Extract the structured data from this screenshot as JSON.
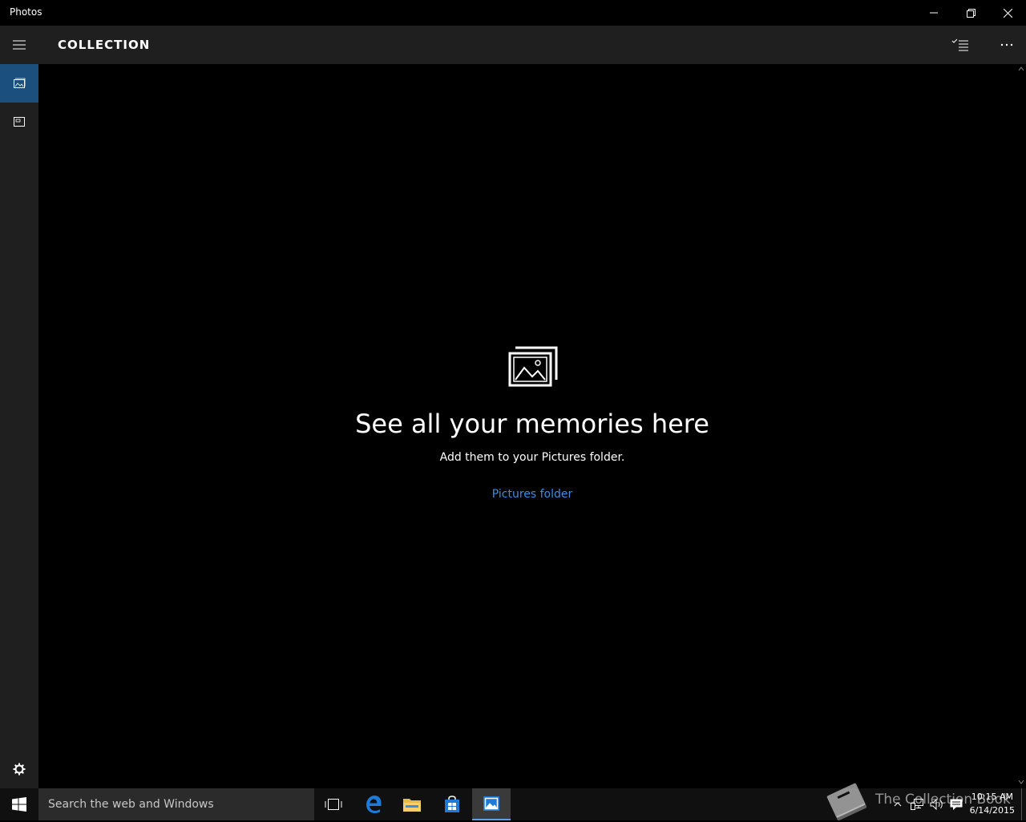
{
  "window": {
    "title": "Photos"
  },
  "header": {
    "title": "COLLECTION"
  },
  "empty_state": {
    "title": "See all your memories here",
    "subtitle": "Add them to your Pictures folder.",
    "link": "Pictures folder"
  },
  "taskbar": {
    "search_placeholder": "Search the web and Windows",
    "watermark": "The Collection Book",
    "time": "10:15 AM",
    "date": "6/14/2015"
  },
  "colors": {
    "accent": "#1b4f7e",
    "link": "#3a8ee6",
    "header_bg": "#1f1f1f",
    "background": "#000000"
  }
}
